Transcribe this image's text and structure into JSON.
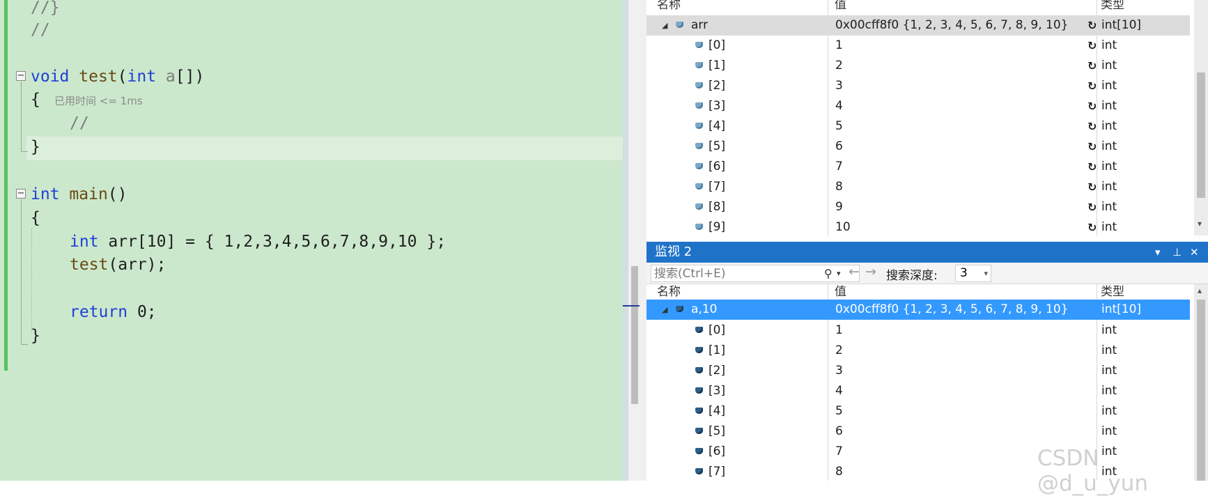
{
  "editor": {
    "lines": {
      "l1": "//}",
      "l2": "//",
      "l3_kw": "void",
      "l3_fn": "test",
      "l3_open": "(",
      "l3_kw2": "int",
      "l3_param": "a",
      "l3_rest": "[])",
      "l4": "{",
      "l5": "//",
      "l6": "}",
      "l7_kw": "int",
      "l7_fn": "main",
      "l7_rest": "()",
      "l8": "{",
      "l9_kw": "int",
      "l9_rest": " arr[10] = { 1,2,3,4,5,6,7,8,9,10 };",
      "l10_fn": "test",
      "l10_rest": "(arr);",
      "l11_kw": "return",
      "l11_rest": " 0;",
      "l12": "}"
    },
    "codelens": "已用时间 <= 1ms",
    "fold_icon": "−"
  },
  "watch1": {
    "headers": {
      "name": "名称",
      "value": "值",
      "type": "类型"
    },
    "parent": {
      "name": "arr",
      "value": "0x00cff8f0 {1, 2, 3, 4, 5, 6, 7, 8, 9, 10}",
      "type": "int[10]",
      "expander": "◢"
    },
    "items": [
      {
        "name": "[0]",
        "value": "1",
        "type": "int"
      },
      {
        "name": "[1]",
        "value": "2",
        "type": "int"
      },
      {
        "name": "[2]",
        "value": "3",
        "type": "int"
      },
      {
        "name": "[3]",
        "value": "4",
        "type": "int"
      },
      {
        "name": "[4]",
        "value": "5",
        "type": "int"
      },
      {
        "name": "[5]",
        "value": "6",
        "type": "int"
      },
      {
        "name": "[6]",
        "value": "7",
        "type": "int"
      },
      {
        "name": "[7]",
        "value": "8",
        "type": "int"
      },
      {
        "name": "[8]",
        "value": "9",
        "type": "int"
      },
      {
        "name": "[9]",
        "value": "10",
        "type": "int"
      }
    ],
    "refresh_icon": "↻",
    "scroll_down": "▾"
  },
  "watch2": {
    "title": "监视 2",
    "controls": {
      "dropdown": "▾",
      "pin": "⊥",
      "close": "✕"
    },
    "search": {
      "placeholder": "搜索(Ctrl+E)",
      "search_icon": "⚲",
      "dropdown": "▾",
      "back": "←",
      "forward": "→"
    },
    "depth": {
      "label": "搜索深度:",
      "value": "3",
      "dropdown": "▾"
    },
    "headers": {
      "name": "名称",
      "value": "值",
      "type": "类型"
    },
    "parent": {
      "name": "a,10",
      "value": "0x00cff8f0 {1, 2, 3, 4, 5, 6, 7, 8, 9, 10}",
      "type": "int[10]",
      "expander": "◢"
    },
    "items": [
      {
        "name": "[0]",
        "value": "1",
        "type": "int"
      },
      {
        "name": "[1]",
        "value": "2",
        "type": "int"
      },
      {
        "name": "[2]",
        "value": "3",
        "type": "int"
      },
      {
        "name": "[3]",
        "value": "4",
        "type": "int"
      },
      {
        "name": "[4]",
        "value": "5",
        "type": "int"
      },
      {
        "name": "[5]",
        "value": "6",
        "type": "int"
      },
      {
        "name": "[6]",
        "value": "7",
        "type": "int"
      },
      {
        "name": "[7]",
        "value": "8",
        "type": "int"
      }
    ],
    "scroll_up": "▴"
  },
  "watermark": "CSDN @d_u_yun",
  "colors": {
    "editor_bg": "#cbe8cc",
    "change_bar": "#57c15c",
    "selection_blue": "#3399ff",
    "title_blue": "#1e73c8",
    "keyword": "#1f3fd6"
  }
}
